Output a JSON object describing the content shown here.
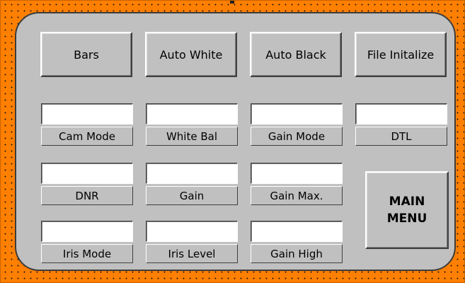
{
  "colors": {
    "frame": "#ff7f00",
    "panel": "#c0c0c0",
    "field": "#ffffff"
  },
  "top_buttons": [
    "Bars",
    "Auto White",
    "Auto Black",
    "File Initalize"
  ],
  "fields": [
    {
      "label": "Cam Mode",
      "value": ""
    },
    {
      "label": "White Bal",
      "value": ""
    },
    {
      "label": "Gain Mode",
      "value": ""
    },
    {
      "label": "DTL",
      "value": ""
    },
    {
      "label": "DNR",
      "value": ""
    },
    {
      "label": "Gain",
      "value": ""
    },
    {
      "label": "Gain Max.",
      "value": ""
    },
    {
      "label": "Iris Mode",
      "value": ""
    },
    {
      "label": "Iris Level",
      "value": ""
    },
    {
      "label": "Gain High",
      "value": ""
    }
  ],
  "main_menu": {
    "line1": "MAIN",
    "line2": "MENU"
  }
}
